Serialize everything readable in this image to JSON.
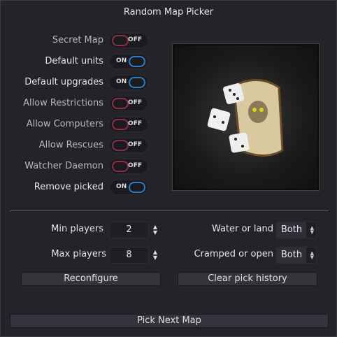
{
  "title": "Random Map Picker",
  "toggles": [
    {
      "label": "Secret Map",
      "state": "OFF"
    },
    {
      "label": "Default units",
      "state": "ON"
    },
    {
      "label": "Default upgrades",
      "state": "ON"
    },
    {
      "label": "Allow Restrictions",
      "state": "OFF"
    },
    {
      "label": "Allow Computers",
      "state": "OFF"
    },
    {
      "label": "Allow Rescues",
      "state": "OFF"
    },
    {
      "label": "Watcher Daemon",
      "state": "OFF"
    },
    {
      "label": "Remove picked",
      "state": "ON"
    }
  ],
  "min_players": {
    "label": "Min players",
    "value": "2"
  },
  "max_players": {
    "label": "Max players",
    "value": "8"
  },
  "water_or_land": {
    "label": "Water or land",
    "value": "Both"
  },
  "cramped_or_open": {
    "label": "Cramped or open",
    "value": "Both"
  },
  "buttons": {
    "reconfigure": "Reconfigure",
    "clear": "Clear pick history",
    "pick": "Pick Next Map"
  },
  "image_icon": "dice-and-map-scroll-icon"
}
